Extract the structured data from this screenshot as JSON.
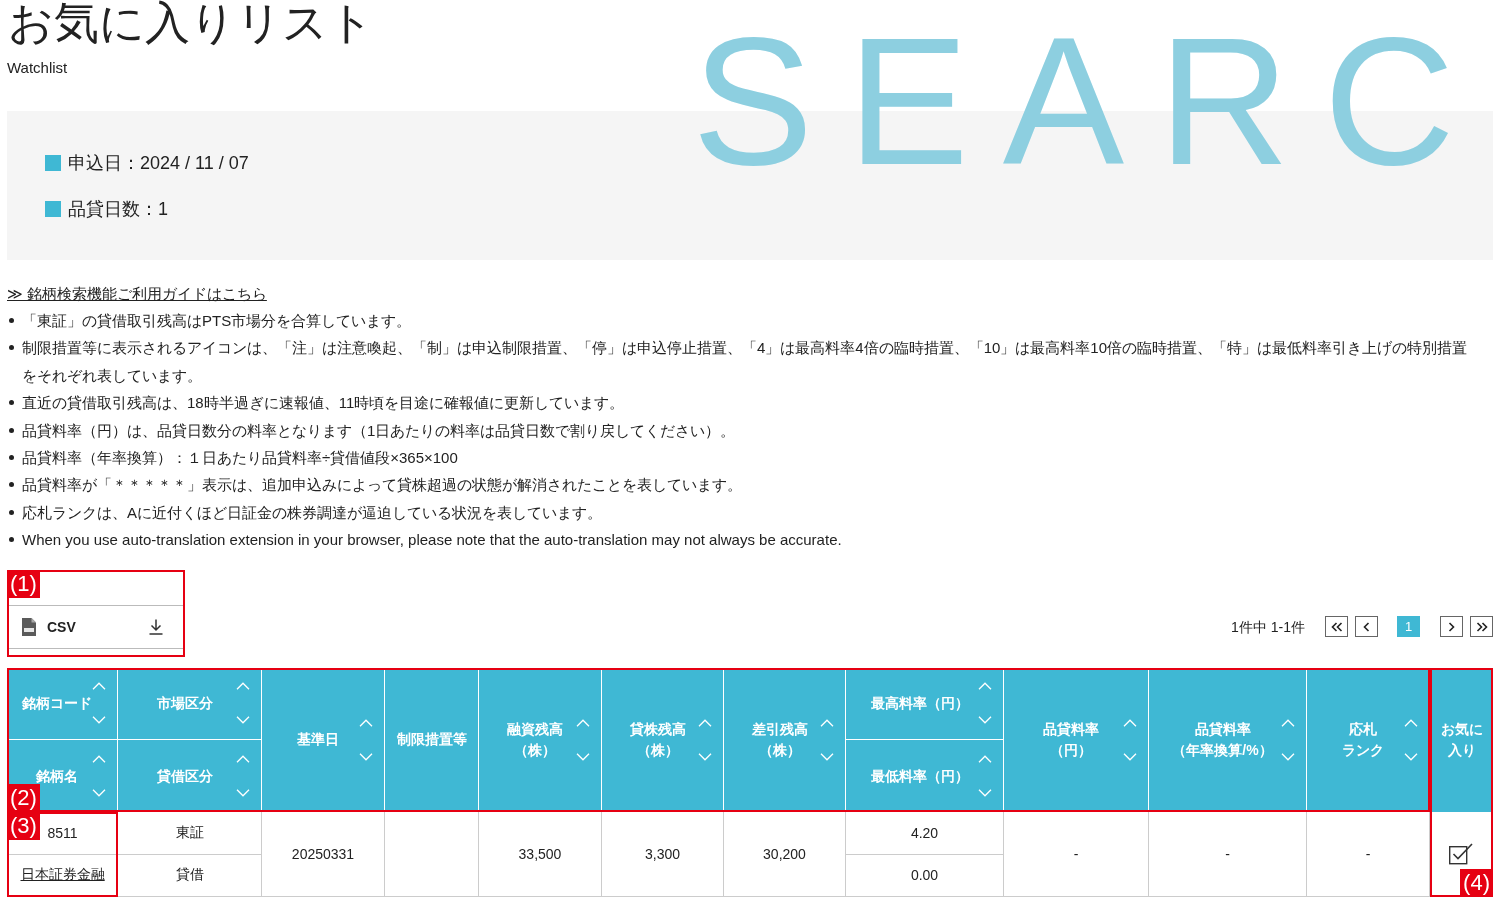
{
  "page": {
    "title": "お気に入りリスト",
    "subtitle": "Watchlist",
    "background_text": "SEARC"
  },
  "info": [
    {
      "text": "申込日：2024 / 11 / 07"
    },
    {
      "text": "品貸日数：1"
    }
  ],
  "guide_link": "≫ 銘柄検索機能ご利用ガイドはこちら",
  "notes": [
    "「東証」の貸借取引残高はPTS市場分を合算しています。",
    "制限措置等に表示されるアイコンは、「注」は注意喚起、「制」は申込制限措置、「停」は申込停止措置、「4」は最高料率4倍の臨時措置、「10」は最高料率10倍の臨時措置、「特」は最低料率引き上げの特別措置をそれぞれ表しています。",
    "直近の貸借取引残高は、18時半過ぎに速報値、11時頃を目途に確報値に更新しています。",
    "品貸料率（円）は、品貸日数分の料率となります（1日あたりの料率は品貸日数で割り戻してください）。",
    "品貸料率（年率換算）：１日あたり品貸料率÷貸借値段×365×100",
    "品貸料率が「＊＊＊＊＊」表示は、追加申込みによって貸株超過の状態が解消されたことを表しています。",
    "応札ランクは、Aに近付くほど日証金の株券調達が逼迫している状況を表しています。",
    "When you use auto-translation extension in your browser, please note that the auto-translation may not always be accurate."
  ],
  "csv_button": {
    "label": "CSV"
  },
  "pagination": {
    "summary": "1件中 1-1件",
    "buttons": [
      {
        "kind": "first"
      },
      {
        "kind": "prev"
      },
      {
        "kind": "page",
        "label": "1",
        "selected": true
      },
      {
        "kind": "next"
      },
      {
        "kind": "last"
      }
    ]
  },
  "table": {
    "columns": [
      {
        "kind": "stacked",
        "parts": [
          {
            "lines": [
              "銘柄コード"
            ],
            "sortable": true
          },
          {
            "lines": [
              "銘柄名"
            ],
            "sortable": true
          }
        ]
      },
      {
        "kind": "stacked",
        "parts": [
          {
            "lines": [
              "市場区分"
            ],
            "sortable": true
          },
          {
            "lines": [
              "貸借区分"
            ],
            "sortable": true
          }
        ]
      },
      {
        "kind": "single",
        "lines": [
          "基準日"
        ],
        "sortable": true
      },
      {
        "kind": "single",
        "lines": [
          "制限措置等"
        ],
        "sortable": false
      },
      {
        "kind": "single",
        "lines": [
          "融資残高",
          "（株）"
        ],
        "sortable": true
      },
      {
        "kind": "single",
        "lines": [
          "貸株残高",
          "（株）"
        ],
        "sortable": true
      },
      {
        "kind": "single",
        "lines": [
          "差引残高",
          "（株）"
        ],
        "sortable": true
      },
      {
        "kind": "stacked",
        "parts": [
          {
            "lines": [
              "最高料率（円）"
            ],
            "sortable": true
          },
          {
            "lines": [
              "最低料率（円）"
            ],
            "sortable": true
          }
        ]
      },
      {
        "kind": "single",
        "lines": [
          "品貸料率",
          "（円）"
        ],
        "sortable": true
      },
      {
        "kind": "single",
        "lines": [
          "品貸料率",
          "（年率換算/%）"
        ],
        "sortable": true
      },
      {
        "kind": "single",
        "lines": [
          "応札",
          "ランク"
        ],
        "sortable": true
      },
      {
        "kind": "single",
        "lines": [
          "お気に",
          "入り"
        ],
        "sortable": false
      }
    ],
    "rows": [
      {
        "cells": [
          {
            "kind": "stacked",
            "values": [
              {
                "kind": "text",
                "text": "8511"
              },
              {
                "kind": "link",
                "text": "日本証券金融"
              }
            ]
          },
          {
            "kind": "stacked",
            "values": [
              {
                "kind": "text",
                "text": "東証"
              },
              {
                "kind": "text",
                "text": "貸借"
              }
            ]
          },
          {
            "kind": "text",
            "text": "20250331"
          },
          {
            "kind": "empty"
          },
          {
            "kind": "text",
            "text": "33,500"
          },
          {
            "kind": "text",
            "text": "3,300"
          },
          {
            "kind": "text",
            "text": "30,200"
          },
          {
            "kind": "stacked",
            "values": [
              {
                "kind": "text",
                "text": "4.20"
              },
              {
                "kind": "text",
                "text": "0.00"
              }
            ]
          },
          {
            "kind": "text",
            "text": "-"
          },
          {
            "kind": "text",
            "text": "-"
          },
          {
            "kind": "text",
            "text": "-"
          },
          {
            "kind": "checkbox",
            "checked": true
          }
        ]
      }
    ]
  },
  "annotations": [
    {
      "label": "(1)",
      "kind": "csv"
    },
    {
      "label": "(2)",
      "kind": "header"
    },
    {
      "label": "(3)",
      "kind": "cell"
    },
    {
      "label": "(4)",
      "kind": "column"
    }
  ]
}
